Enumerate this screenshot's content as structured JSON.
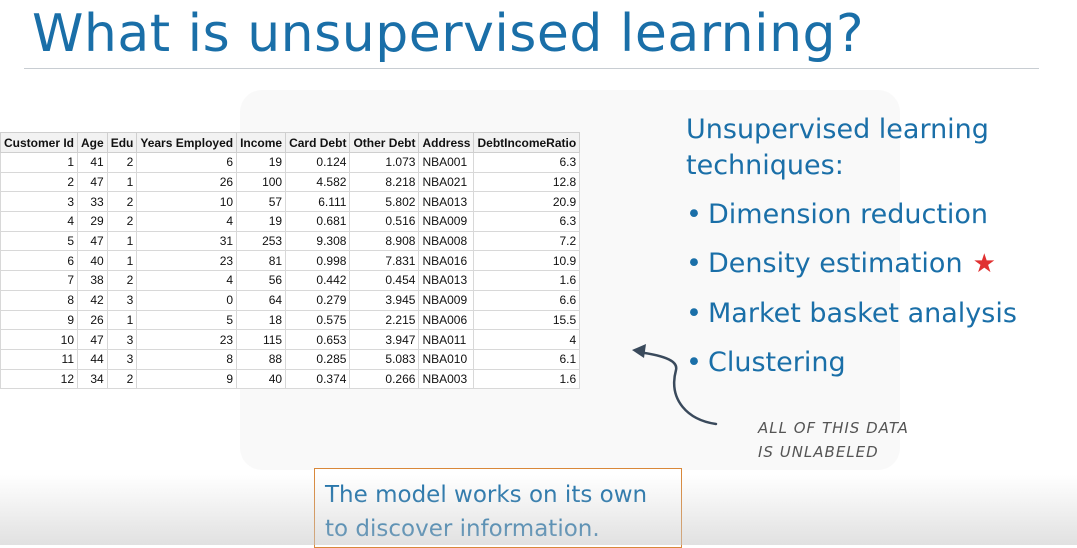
{
  "slide": {
    "title": "What is unsupervised learning?"
  },
  "table": {
    "headers": [
      "Customer Id",
      "Age",
      "Edu",
      "Years Employed",
      "Income",
      "Card Debt",
      "Other Debt",
      "Address",
      "DebtIncomeRatio"
    ],
    "rows": [
      [
        "1",
        "41",
        "2",
        "6",
        "19",
        "0.124",
        "1.073",
        "NBA001",
        "6.3"
      ],
      [
        "2",
        "47",
        "1",
        "26",
        "100",
        "4.582",
        "8.218",
        "NBA021",
        "12.8"
      ],
      [
        "3",
        "33",
        "2",
        "10",
        "57",
        "6.111",
        "5.802",
        "NBA013",
        "20.9"
      ],
      [
        "4",
        "29",
        "2",
        "4",
        "19",
        "0.681",
        "0.516",
        "NBA009",
        "6.3"
      ],
      [
        "5",
        "47",
        "1",
        "31",
        "253",
        "9.308",
        "8.908",
        "NBA008",
        "7.2"
      ],
      [
        "6",
        "40",
        "1",
        "23",
        "81",
        "0.998",
        "7.831",
        "NBA016",
        "10.9"
      ],
      [
        "7",
        "38",
        "2",
        "4",
        "56",
        "0.442",
        "0.454",
        "NBA013",
        "1.6"
      ],
      [
        "8",
        "42",
        "3",
        "0",
        "64",
        "0.279",
        "3.945",
        "NBA009",
        "6.6"
      ],
      [
        "9",
        "26",
        "1",
        "5",
        "18",
        "0.575",
        "2.215",
        "NBA006",
        "15.5"
      ],
      [
        "10",
        "47",
        "3",
        "23",
        "115",
        "0.653",
        "3.947",
        "NBA011",
        "4"
      ],
      [
        "11",
        "44",
        "3",
        "8",
        "88",
        "0.285",
        "5.083",
        "NBA010",
        "6.1"
      ],
      [
        "12",
        "34",
        "2",
        "9",
        "40",
        "0.374",
        "0.266",
        "NBA003",
        "1.6"
      ]
    ]
  },
  "techniques": {
    "heading_line1": "Unsupervised learning",
    "heading_line2": "techniques:",
    "items": [
      {
        "label": "Dimension reduction",
        "starred": false
      },
      {
        "label": "Density estimation",
        "starred": true
      },
      {
        "label": "Market basket analysis",
        "starred": false
      },
      {
        "label": "Clustering",
        "starred": false
      }
    ],
    "bullet": "•",
    "star_icon": "★"
  },
  "annotation": {
    "line1": "ALL OF THIS DATA",
    "line2": "IS UNLABELED"
  },
  "callout": {
    "line1": "The model works on its own",
    "line2": "to discover information."
  },
  "colors": {
    "accent": "#1a6fa8",
    "star": "#e03030",
    "callout_border": "#d9883a"
  }
}
